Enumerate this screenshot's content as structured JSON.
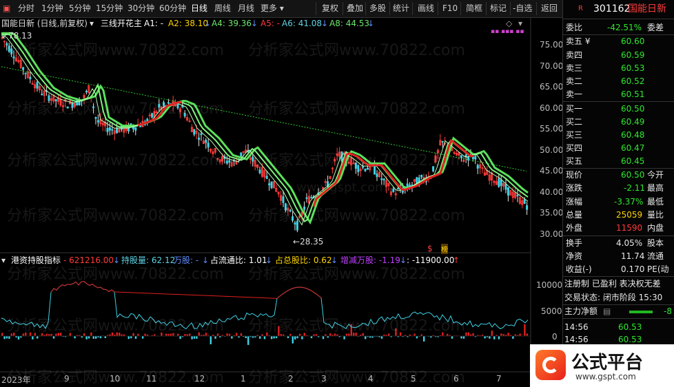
{
  "toolbar": {
    "left_items": [
      "分时",
      "1分钟",
      "5分钟",
      "15分钟",
      "30分钟",
      "60分钟",
      "日线",
      "周线",
      "月线",
      "更多"
    ],
    "active": "日线",
    "right_items": [
      "复权",
      "叠加",
      "多股",
      "统计",
      "画线",
      "F10",
      "简框",
      "标记",
      "-自选",
      "返回"
    ]
  },
  "chart_header": {
    "title": "国能日新 (日线,前复权)",
    "formula": "三线开花主",
    "a1": "A1: -",
    "a2": "A2: 38.10",
    "a4": "A4: 39.36",
    "a5": "A5: -",
    "a6": "A6: 41.08",
    "a8": "A8: 44.53"
  },
  "price_axis": [
    "75.00",
    "70.00",
    "65.00",
    "60.00",
    "55.00",
    "50.00",
    "45.00",
    "40.00",
    "35.00",
    "30.00"
  ],
  "price_marks": {
    "high": "78.13",
    "low": "28.35"
  },
  "indicator_header": {
    "name": "港资持股指标",
    "v1": "621216.00",
    "v2": "持股量: 62.12",
    "v3": "万股: -",
    "v4": "占流通比: 1.01",
    "v5": "占总股比: 0.62",
    "v6": "增减万股: -1.19",
    "v7": ": -11900.00"
  },
  "indicator_axis": [
    "10000",
    "5000",
    "0"
  ],
  "date_axis": [
    "2023年",
    "9",
    "10",
    "11",
    "12",
    "1",
    "2",
    "3",
    "4",
    "5",
    "6",
    "7"
  ],
  "watermarks": [
    "分析家公式网www.70822.com",
    "www.gspt.com"
  ],
  "panel": {
    "code": "301162",
    "name": "国能日新",
    "r_badge": "R",
    "weibi_label": "委比",
    "weibi_value": "-42.51%",
    "weicha_label": "委差",
    "asks": [
      {
        "label": "卖五 ¥",
        "price": "60.60"
      },
      {
        "label": "卖四",
        "price": "60.59"
      },
      {
        "label": "卖三",
        "price": "60.53"
      },
      {
        "label": "卖二",
        "price": "60.52"
      },
      {
        "label": "卖一",
        "price": "60.51"
      }
    ],
    "bids": [
      {
        "label": "买一",
        "price": "60.50"
      },
      {
        "label": "买二",
        "price": "60.49"
      },
      {
        "label": "买三",
        "price": "60.48"
      },
      {
        "label": "买四",
        "price": "60.47"
      },
      {
        "label": "买五",
        "price": "60.45"
      }
    ],
    "quote": [
      {
        "label": "现价",
        "value": "60.50",
        "label2": "今开",
        "color": "green"
      },
      {
        "label": "涨跌",
        "value": "-2.11",
        "label2": "最高",
        "color": "green"
      },
      {
        "label": "涨幅",
        "value": "-3.37%",
        "label2": "最低",
        "color": "green"
      },
      {
        "label": "总量",
        "value": "25059",
        "label2": "量比",
        "color": "yellow"
      },
      {
        "label": "外盘",
        "value": "11590",
        "label2": "内盘",
        "color": "red"
      }
    ],
    "stats": [
      {
        "label": "换手",
        "value": "4.05%",
        "label2": "股本"
      },
      {
        "label": "净资",
        "value": "11.74",
        "label2": "流通"
      },
      {
        "label": "收益(-)",
        "value": "0.170",
        "label2": "PE(动"
      }
    ],
    "flags": "注册制  已盈利  表决权无差",
    "trade_state": "交易状态: 闭市阶段 15:30",
    "main_flow_label": "主力净额",
    "main_flow_value": "-8",
    "ticks": [
      {
        "time": "14:56",
        "price": "60.53"
      },
      {
        "time": "14:56",
        "price": "60.53"
      }
    ],
    "logo_text": "公式平台",
    "logo_url": "www.gspt.com"
  },
  "colors": {
    "up": "#ff3b3b",
    "down": "#2ee82e",
    "ma": "#7cf27c",
    "bg": "#000000",
    "accent": "#ffd500"
  }
}
